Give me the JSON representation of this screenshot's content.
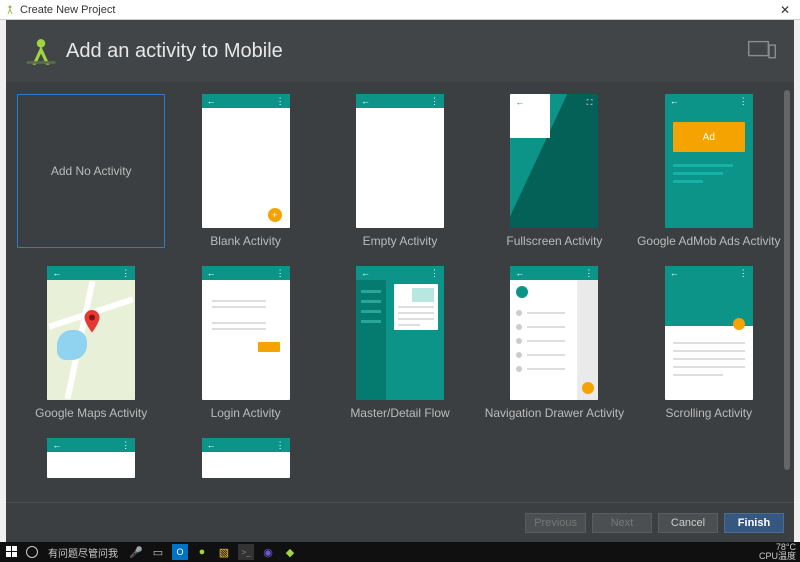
{
  "titlebar": {
    "title": "Create New Project"
  },
  "header": {
    "heading": "Add an activity to Mobile"
  },
  "tiles": [
    {
      "label": "Add No Activity"
    },
    {
      "label": "Blank Activity"
    },
    {
      "label": "Empty Activity"
    },
    {
      "label": "Fullscreen Activity"
    },
    {
      "label": "Google AdMob Ads Activity",
      "ad": "Ad"
    },
    {
      "label": "Google Maps Activity"
    },
    {
      "label": "Login Activity"
    },
    {
      "label": "Master/Detail Flow"
    },
    {
      "label": "Navigation Drawer Activity"
    },
    {
      "label": "Scrolling Activity"
    }
  ],
  "footer": {
    "previous": "Previous",
    "next": "Next",
    "cancel": "Cancel",
    "finish": "Finish"
  },
  "taskbar": {
    "search": "有问题尽管问我",
    "temp": "78°C",
    "temp_label": "CPU温度"
  }
}
